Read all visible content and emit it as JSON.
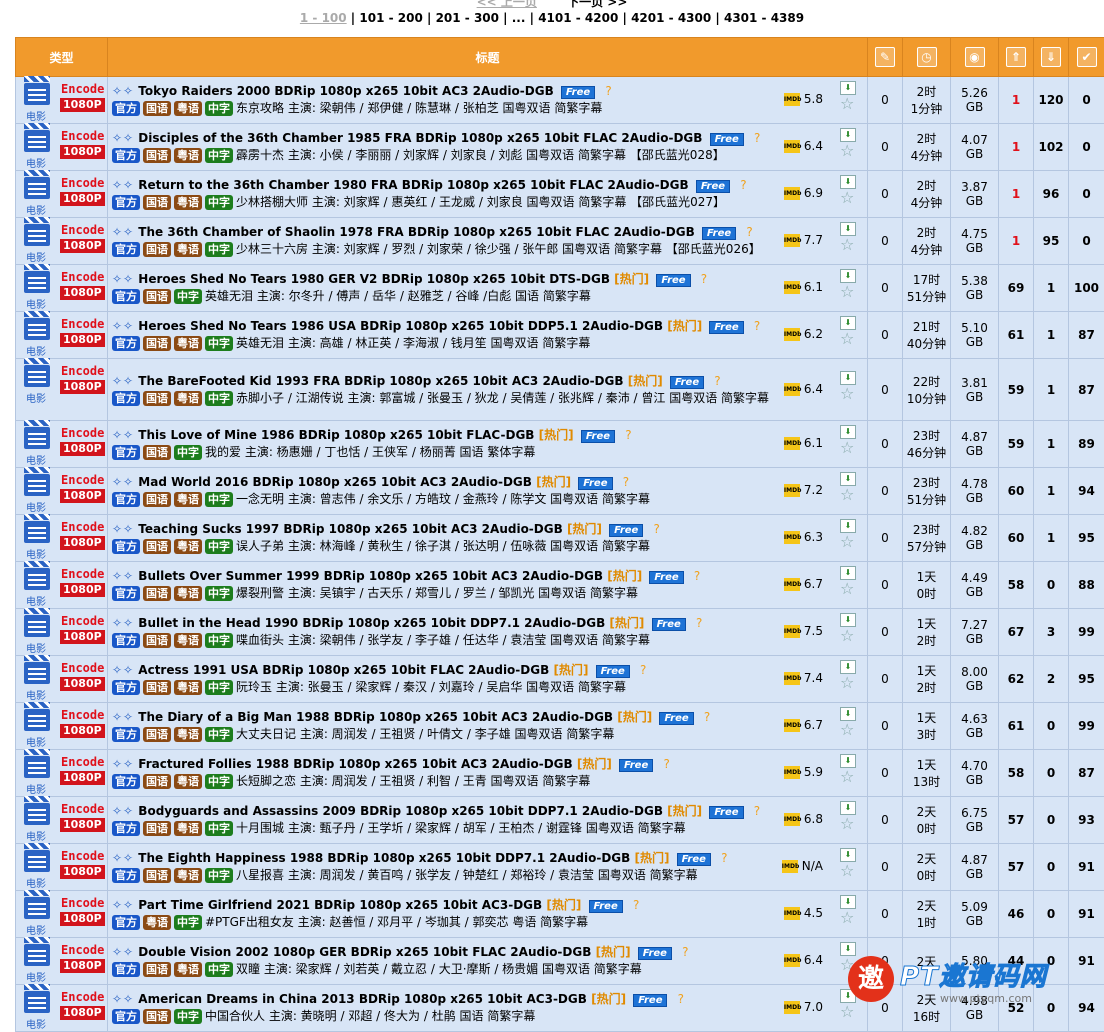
{
  "pager": {
    "prev": "<< 上一页",
    "next": "下一页 >>",
    "current": "1 - 100",
    "pages": [
      "101 - 200",
      "201 - 300",
      "...",
      "4101 - 4200",
      "4201 - 4300",
      "4301 - 4389"
    ]
  },
  "headers": {
    "type": "类型",
    "title": "标题",
    "icons": [
      "comment-icon",
      "clock-icon",
      "disk-icon",
      "seeders-icon",
      "leechers-icon",
      "completed-icon"
    ]
  },
  "type_label": {
    "category": "电影",
    "codec": "Encode",
    "resolution": "1080P"
  },
  "tags": {
    "official": "官方",
    "mandarin": "国语",
    "cantonese": "粤语",
    "chinese_sub": "中字"
  },
  "hot_label": "热门",
  "free_label": "Free",
  "imdb_label": "IMDb",
  "rows": [
    {
      "title": "Tokyo Raiders 2000 BDRip 1080p x265 10bit AC3 2Audio-DGB",
      "hot": false,
      "tags": [
        "官方",
        "国语",
        "粤语",
        "中字"
      ],
      "desc": "东京攻略 主演: 梁朝伟 / 郑伊健 / 陈慧琳 / 张柏芝 国粤双语 简繁字幕",
      "imdb": "5.8",
      "comments": "0",
      "time1": "2时",
      "time2": "1分钟",
      "size1": "5.26",
      "size2": "GB",
      "seeders": "1",
      "leechers": "120",
      "completed": "0"
    },
    {
      "title": "Disciples of the 36th Chamber 1985 FRA BDRip 1080p x265 10bit FLAC 2Audio-DGB",
      "hot": false,
      "tags": [
        "官方",
        "国语",
        "粤语",
        "中字"
      ],
      "desc": "霹雳十杰 主演: 小侯 / 李丽丽 / 刘家辉 / 刘家良 / 刘彪 国粤双语 简繁字幕 【邵氏蓝光028】",
      "imdb": "6.4",
      "comments": "0",
      "time1": "2时",
      "time2": "4分钟",
      "size1": "4.07",
      "size2": "GB",
      "seeders": "1",
      "leechers": "102",
      "completed": "0"
    },
    {
      "title": "Return to the 36th Chamber 1980 FRA BDRip 1080p x265 10bit FLAC 2Audio-DGB",
      "hot": false,
      "tags": [
        "官方",
        "国语",
        "粤语",
        "中字"
      ],
      "desc": "少林搭棚大师 主演: 刘家辉 / 惠英红 / 王龙威 / 刘家良 国粤双语 简繁字幕 【邵氏蓝光027】",
      "imdb": "6.9",
      "comments": "0",
      "time1": "2时",
      "time2": "4分钟",
      "size1": "3.87",
      "size2": "GB",
      "seeders": "1",
      "leechers": "96",
      "completed": "0"
    },
    {
      "title": "The 36th Chamber of Shaolin 1978 FRA BDRip 1080p x265 10bit FLAC 2Audio-DGB",
      "hot": false,
      "tags": [
        "官方",
        "国语",
        "粤语",
        "中字"
      ],
      "desc": "少林三十六房 主演: 刘家辉 / 罗烈 / 刘家荣 / 徐少强 / 张午郎 国粤双语 简繁字幕 【邵氏蓝光026】",
      "imdb": "7.7",
      "comments": "0",
      "time1": "2时",
      "time2": "4分钟",
      "size1": "4.75",
      "size2": "GB",
      "seeders": "1",
      "leechers": "95",
      "completed": "0"
    },
    {
      "title": "Heroes Shed No Tears 1980 GER V2 BDRip 1080p x265 10bit DTS-DGB",
      "hot": true,
      "tags": [
        "官方",
        "国语",
        "中字"
      ],
      "desc": "英雄无泪 主演: 尔冬升 / 傅声 / 岳华 / 赵雅芝 / 谷峰 /白彪 国语 简繁字幕",
      "imdb": "6.1",
      "comments": "0",
      "time1": "17时",
      "time2": "51分钟",
      "size1": "5.38",
      "size2": "GB",
      "seeders": "69",
      "leechers": "1",
      "completed": "100"
    },
    {
      "title": "Heroes Shed No Tears 1986 USA BDRip 1080p x265 10bit DDP5.1 2Audio-DGB",
      "hot": true,
      "tags": [
        "官方",
        "国语",
        "粤语",
        "中字"
      ],
      "desc": "英雄无泪 主演: 高雄 / 林正英 / 李海淑 / 钱月笙 国粤双语 简繁字幕",
      "imdb": "6.2",
      "comments": "0",
      "time1": "21时",
      "time2": "40分钟",
      "size1": "5.10",
      "size2": "GB",
      "seeders": "61",
      "leechers": "1",
      "completed": "87"
    },
    {
      "title": "The BareFooted Kid 1993 FRA BDRip 1080p x265 10bit AC3 2Audio-DGB",
      "hot": true,
      "tags": [
        "官方",
        "国语",
        "粤语",
        "中字"
      ],
      "desc": "赤脚小子 / 江湖传说 主演: 郭富城 / 张曼玉 / 狄龙 / 吴倩莲 / 张兆辉 / 秦沛 / 曾江 国粤双语 简繁字幕",
      "imdb": "6.4",
      "comments": "0",
      "time1": "22时",
      "time2": "10分钟",
      "size1": "3.81",
      "size2": "GB",
      "seeders": "59",
      "leechers": "1",
      "completed": "87",
      "tall": true
    },
    {
      "title": "This Love of Mine 1986 BDRip 1080p x265 10bit FLAC-DGB",
      "hot": true,
      "tags": [
        "官方",
        "国语",
        "中字"
      ],
      "desc": "我的爱 主演: 杨惠姗 / 丁也恬 / 王侠军 / 杨丽菁 国语 繁体字幕",
      "imdb": "6.1",
      "comments": "0",
      "time1": "23时",
      "time2": "46分钟",
      "size1": "4.87",
      "size2": "GB",
      "seeders": "59",
      "leechers": "1",
      "completed": "89"
    },
    {
      "title": "Mad World 2016 BDRip 1080p x265 10bit AC3 2Audio-DGB",
      "hot": true,
      "tags": [
        "官方",
        "国语",
        "粤语",
        "中字"
      ],
      "desc": "一念无明 主演: 曾志伟 / 余文乐 / 方皓玟 / 金燕玲 / 陈学文 国粤双语 简繁字幕",
      "imdb": "7.2",
      "comments": "0",
      "time1": "23时",
      "time2": "51分钟",
      "size1": "4.78",
      "size2": "GB",
      "seeders": "60",
      "leechers": "1",
      "completed": "94"
    },
    {
      "title": "Teaching Sucks 1997 BDRip 1080p x265 10bit AC3 2Audio-DGB",
      "hot": true,
      "tags": [
        "官方",
        "国语",
        "粤语",
        "中字"
      ],
      "desc": "误人子弟 主演: 林海峰 / 黄秋生 / 徐子淇 / 张达明 / 伍咏薇 国粤双语 简繁字幕",
      "imdb": "6.3",
      "comments": "0",
      "time1": "23时",
      "time2": "57分钟",
      "size1": "4.82",
      "size2": "GB",
      "seeders": "60",
      "leechers": "1",
      "completed": "95"
    },
    {
      "title": "Bullets Over Summer 1999 BDRip 1080p x265 10bit AC3 2Audio-DGB",
      "hot": true,
      "tags": [
        "官方",
        "国语",
        "粤语",
        "中字"
      ],
      "desc": "爆裂刑警 主演: 吴镇宇 / 古天乐 / 郑雪儿 / 罗兰 / 邹凯光 国粤双语 简繁字幕",
      "imdb": "6.7",
      "comments": "0",
      "time1": "1天",
      "time2": "0时",
      "size1": "4.49",
      "size2": "GB",
      "seeders": "58",
      "leechers": "0",
      "completed": "88"
    },
    {
      "title": "Bullet in the Head 1990 BDRip 1080p x265 10bit DDP7.1 2Audio-DGB",
      "hot": true,
      "tags": [
        "官方",
        "国语",
        "粤语",
        "中字"
      ],
      "desc": "喋血街头 主演: 梁朝伟 / 张学友 / 李子雄 / 任达华 / 袁洁莹 国粤双语 简繁字幕",
      "imdb": "7.5",
      "comments": "0",
      "time1": "1天",
      "time2": "2时",
      "size1": "7.27",
      "size2": "GB",
      "seeders": "67",
      "leechers": "3",
      "completed": "99"
    },
    {
      "title": "Actress 1991 USA BDRip 1080p x265 10bit FLAC 2Audio-DGB",
      "hot": true,
      "tags": [
        "官方",
        "国语",
        "粤语",
        "中字"
      ],
      "desc": "阮玲玉 主演: 张曼玉 / 梁家辉 / 秦汉 / 刘嘉玲 / 吴启华 国粤双语 简繁字幕",
      "imdb": "7.4",
      "comments": "0",
      "time1": "1天",
      "time2": "2时",
      "size1": "8.00",
      "size2": "GB",
      "seeders": "62",
      "leechers": "2",
      "completed": "95"
    },
    {
      "title": "The Diary of a Big Man 1988 BDRip 1080p x265 10bit AC3 2Audio-DGB",
      "hot": true,
      "tags": [
        "官方",
        "国语",
        "粤语",
        "中字"
      ],
      "desc": "大丈夫日记 主演: 周润发 / 王祖贤 / 叶倩文 / 李子雄 国粤双语 简繁字幕",
      "imdb": "6.7",
      "comments": "0",
      "time1": "1天",
      "time2": "3时",
      "size1": "4.63",
      "size2": "GB",
      "seeders": "61",
      "leechers": "0",
      "completed": "99"
    },
    {
      "title": "Fractured Follies 1988 BDRip 1080p x265 10bit AC3 2Audio-DGB",
      "hot": true,
      "tags": [
        "官方",
        "国语",
        "粤语",
        "中字"
      ],
      "desc": "长短脚之恋 主演: 周润发 / 王祖贤 / 利智 / 王青 国粤双语 简繁字幕",
      "imdb": "5.9",
      "comments": "0",
      "time1": "1天",
      "time2": "13时",
      "size1": "4.70",
      "size2": "GB",
      "seeders": "58",
      "leechers": "0",
      "completed": "87"
    },
    {
      "title": "Bodyguards and Assassins 2009 BDRip 1080p x265 10bit DDP7.1 2Audio-DGB",
      "hot": true,
      "tags": [
        "官方",
        "国语",
        "粤语",
        "中字"
      ],
      "desc": "十月围城 主演: 甄子丹 / 王学圻 / 梁家辉 / 胡军 / 王柏杰 / 谢霆锋 国粤双语 简繁字幕",
      "imdb": "6.8",
      "comments": "0",
      "time1": "2天",
      "time2": "0时",
      "size1": "6.75",
      "size2": "GB",
      "seeders": "57",
      "leechers": "0",
      "completed": "93"
    },
    {
      "title": "The Eighth Happiness 1988 BDRip 1080p x265 10bit DDP7.1 2Audio-DGB",
      "hot": true,
      "tags": [
        "官方",
        "国语",
        "粤语",
        "中字"
      ],
      "desc": "八星报喜 主演: 周润发 / 黄百鸣 / 张学友 / 钟楚红 / 郑裕玲 / 袁洁莹 国粤双语 简繁字幕",
      "imdb": "N/A",
      "comments": "0",
      "time1": "2天",
      "time2": "0时",
      "size1": "4.87",
      "size2": "GB",
      "seeders": "57",
      "leechers": "0",
      "completed": "91"
    },
    {
      "title": "Part Time Girlfriend 2021 BDRip 1080p x265 10bit AC3-DGB",
      "hot": true,
      "tags": [
        "官方",
        "粤语",
        "中字"
      ],
      "desc": "#PTGF出租女友 主演: 赵善恒 / 邓月平 / 岑珈其 / 郭奕芯 粤语 简繁字幕",
      "imdb": "4.5",
      "comments": "0",
      "time1": "2天",
      "time2": "1时",
      "size1": "5.09",
      "size2": "GB",
      "seeders": "46",
      "leechers": "0",
      "completed": "91"
    },
    {
      "title": "Double Vision 2002 1080p GER BDRip x265 10bit FLAC 2Audio-DGB",
      "hot": true,
      "tags": [
        "官方",
        "国语",
        "粤语",
        "中字"
      ],
      "desc": "双瞳 主演: 梁家辉 / 刘若英 / 戴立忍 / 大卫·摩斯 / 杨贵媚 国粤双语 简繁字幕",
      "imdb": "6.4",
      "comments": "0",
      "time1": "2天",
      "time2": "",
      "size1": "5.80",
      "size2": "",
      "seeders": "44",
      "leechers": "0",
      "completed": "91"
    },
    {
      "title": "American Dreams in China 2013 BDRip 1080p x265 10bit AC3-DGB",
      "hot": true,
      "tags": [
        "官方",
        "国语",
        "中字"
      ],
      "desc": "中国合伙人 主演: 黄晓明 / 邓超 / 佟大为 / 杜鹃 国语 简繁字幕",
      "imdb": "7.0",
      "comments": "0",
      "time1": "2天",
      "time2": "16时",
      "size1": "4.98",
      "size2": "GB",
      "seeders": "52",
      "leechers": "0",
      "completed": "94"
    }
  ],
  "watermark": {
    "logo_char": "邀",
    "text": "PT邀请码网",
    "url": "www.ptyqm.com"
  }
}
